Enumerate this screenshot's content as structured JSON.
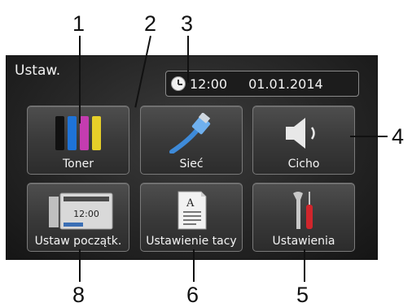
{
  "screen": {
    "title": "Ustaw.",
    "time": "12:00",
    "date": "01.01.2014"
  },
  "tiles": [
    {
      "label": "Toner",
      "icon": "toner-icon"
    },
    {
      "label": "Sieć",
      "icon": "network-cable-icon"
    },
    {
      "label": "Cicho",
      "icon": "speaker-icon"
    },
    {
      "label": "Ustaw początk.",
      "icon": "home-screen-icon"
    },
    {
      "label": "Ustawienie tacy",
      "icon": "paper-tray-icon"
    },
    {
      "label": "Ustawienia",
      "icon": "wrench-screwdriver-icon"
    }
  ],
  "mini_screen_time": "12:00",
  "paper_letter": "A",
  "toner_colors": [
    "#111111",
    "#1e73d8",
    "#c43cb0",
    "#e6cf29"
  ],
  "callouts": [
    "1",
    "2",
    "3",
    "4",
    "5",
    "6",
    "8"
  ]
}
